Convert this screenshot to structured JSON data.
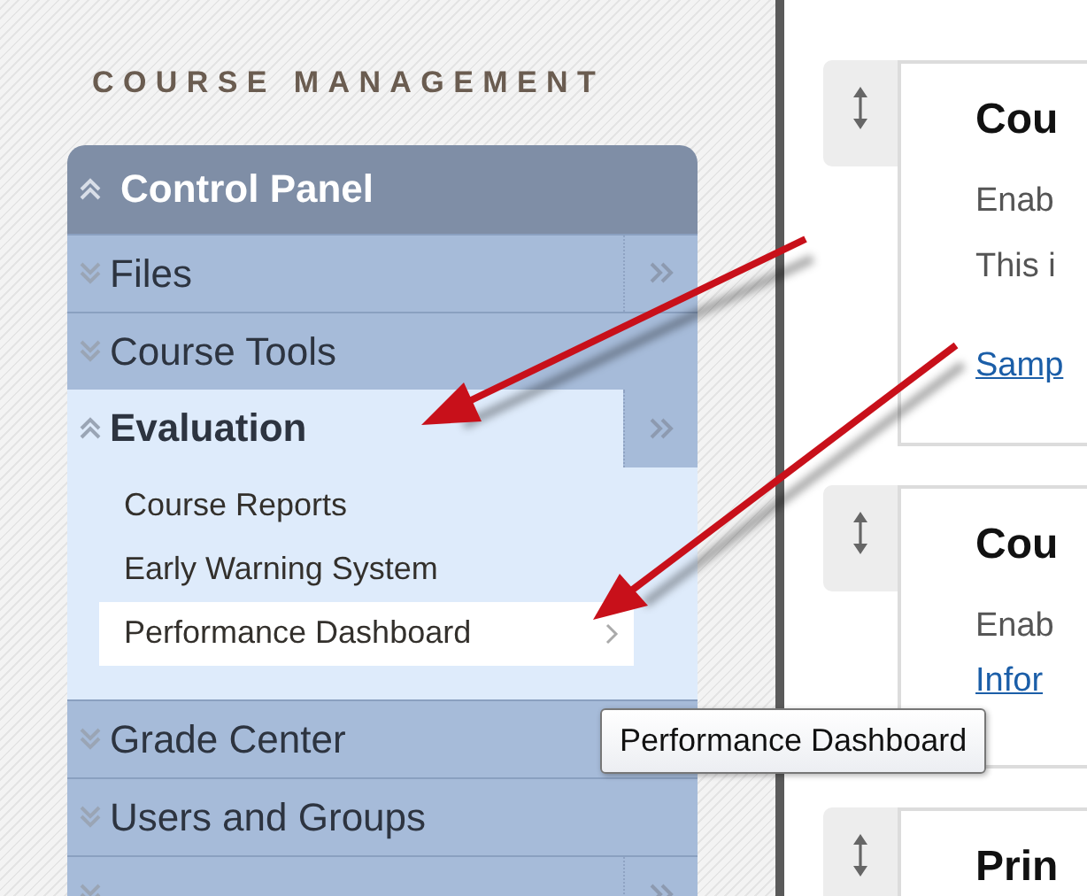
{
  "sidebar": {
    "heading": "COURSE MANAGEMENT",
    "panel": {
      "title": "Control Panel",
      "expanded": true
    },
    "items": [
      {
        "label": "Files",
        "expanded": false,
        "menu_arrow": true
      },
      {
        "label": "Course Tools",
        "expanded": false,
        "menu_arrow": false
      },
      {
        "label": "Evaluation",
        "expanded": true,
        "menu_arrow": true,
        "children": [
          {
            "label": "Course Reports",
            "selected": false
          },
          {
            "label": "Early Warning System",
            "selected": false
          },
          {
            "label": "Performance Dashboard",
            "selected": true
          }
        ]
      },
      {
        "label": "Grade Center",
        "expanded": false,
        "menu_arrow": false
      },
      {
        "label": "Users and Groups",
        "expanded": false,
        "menu_arrow": false
      },
      {
        "expanded": false,
        "menu_arrow": true
      }
    ]
  },
  "tooltip": "Performance Dashboard",
  "modules": [
    {
      "title": "Cou",
      "lines": [
        {
          "kind": "text",
          "text": "Enab"
        },
        {
          "kind": "text",
          "text": "This i"
        },
        {
          "kind": "link",
          "text": "Samp"
        }
      ]
    },
    {
      "title": "Cou",
      "lines": [
        {
          "kind": "text",
          "text": "Enab"
        },
        {
          "kind": "link",
          "text": "Infor"
        }
      ]
    },
    {
      "title": "Prin"
    }
  ]
}
